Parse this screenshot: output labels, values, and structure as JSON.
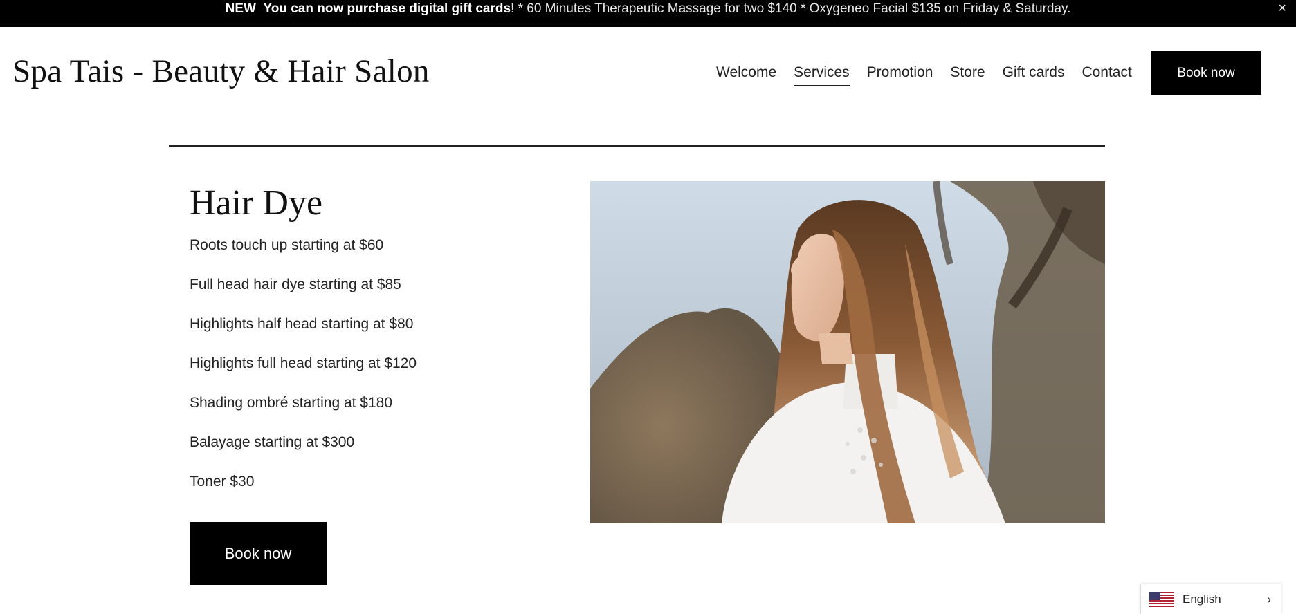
{
  "announcement": {
    "new_label": "NEW",
    "highlight": "You can now purchase digital gift cards",
    "details": "! * 60 Minutes Therapeutic Massage for two $140 * Oxygeneo Facial $135 on Friday & Saturday.",
    "close_symbol": "×"
  },
  "header": {
    "logo": "Spa Tais - Beauty & Hair Salon",
    "nav": [
      {
        "label": "Welcome",
        "active": false
      },
      {
        "label": "Services",
        "active": true
      },
      {
        "label": "Promotion",
        "active": false
      },
      {
        "label": "Store",
        "active": false
      },
      {
        "label": "Gift cards",
        "active": false
      },
      {
        "label": "Contact",
        "active": false
      }
    ],
    "book_label": "Book now"
  },
  "section": {
    "title": "Hair Dye",
    "items": [
      "Roots touch up starting at $60",
      "Full head hair dye starting at $85",
      "Highlights half head starting at $80",
      "Highlights full head starting at $120",
      "Shading ombré starting at $180",
      "Balayage starting at $300",
      "Toner $30"
    ],
    "book_label": "Book now"
  },
  "language": {
    "label": "English",
    "flag_icon": "us-flag-icon",
    "chevron": "›"
  },
  "colors": {
    "bar": "#000000",
    "button": "#000000",
    "text": "#111111"
  }
}
